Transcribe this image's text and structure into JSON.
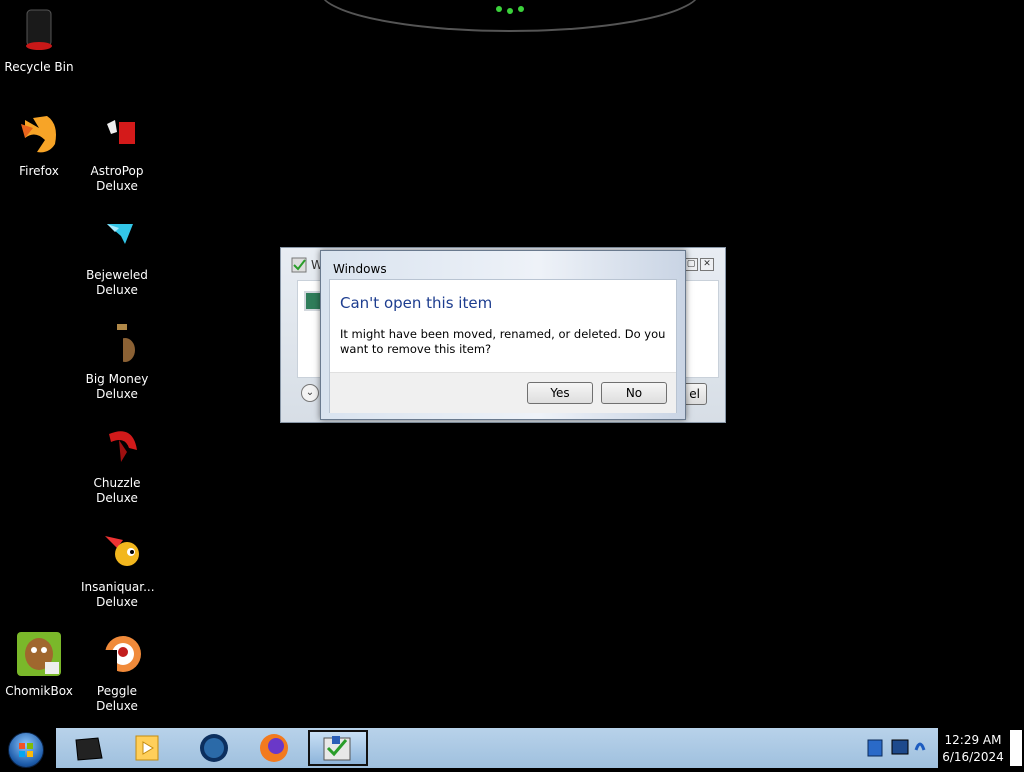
{
  "desktop": {
    "icons": [
      {
        "label": "Recycle Bin"
      },
      {
        "label": "Firefox"
      },
      {
        "label": "AstroPop\nDeluxe"
      },
      {
        "label": "Bejeweled\nDeluxe"
      },
      {
        "label": "Big Money\nDeluxe"
      },
      {
        "label": "Chuzzle\nDeluxe"
      },
      {
        "label": "Insaniquar...\nDeluxe"
      },
      {
        "label": "ChomikBox"
      },
      {
        "label": "Peggle Deluxe"
      }
    ]
  },
  "background_window": {
    "title_fragment": "W",
    "cancel_fragment": "el"
  },
  "dialog": {
    "title": "Windows",
    "heading": "Can't open this item",
    "message": "It might have been moved, renamed, or deleted. Do you want to remove this item?",
    "yes_label": "Yes",
    "no_label": "No"
  },
  "taskbar": {
    "time": "12:29 AM",
    "date": "6/16/2024"
  },
  "colors": {
    "heading": "#1d3d8f",
    "taskbar": "#b8d2ea"
  }
}
